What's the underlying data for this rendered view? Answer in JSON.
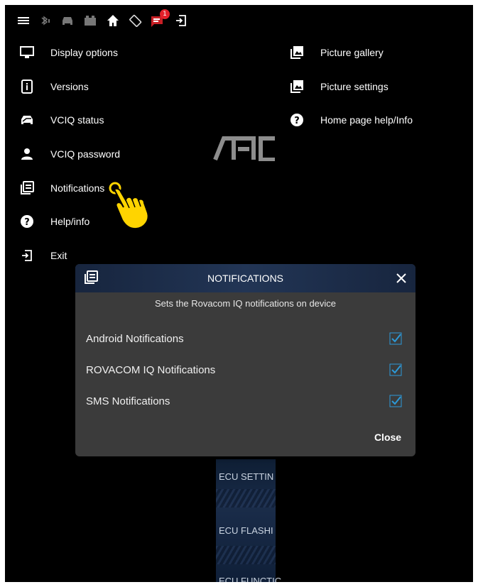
{
  "menu_left": [
    {
      "label": "Display options",
      "icon": "monitor-icon"
    },
    {
      "label": "Versions",
      "icon": "info-box-icon"
    },
    {
      "label": "VCIQ status",
      "icon": "car-icon"
    },
    {
      "label": "VCIQ password",
      "icon": "person-icon"
    },
    {
      "label": "Notifications",
      "icon": "notifications-icon"
    },
    {
      "label": "Help/info",
      "icon": "help-icon"
    },
    {
      "label": "Exit",
      "icon": "exit-icon"
    }
  ],
  "menu_right": [
    {
      "label": "Picture gallery",
      "icon": "image-icon"
    },
    {
      "label": "Picture settings",
      "icon": "image-icon"
    },
    {
      "label": "Home page help/Info",
      "icon": "help-icon"
    }
  ],
  "status_badge": "1",
  "background": {
    "tiles": [
      "ECU SETTIN",
      "ECU FLASHI",
      "ECU FUNCTIC"
    ]
  },
  "dialog": {
    "title": "NOTIFICATIONS",
    "subtitle": "Sets the Rovacom IQ notifications on device",
    "options": [
      {
        "label": "Android Notifications",
        "checked": true
      },
      {
        "label": "ROVACOM IQ Notifications",
        "checked": true
      },
      {
        "label": "SMS Notifications",
        "checked": true
      }
    ],
    "close_label": "Close"
  },
  "colors": {
    "check": "#2c9ad8",
    "badge": "#e5202a",
    "pointer": "#ffd400"
  }
}
